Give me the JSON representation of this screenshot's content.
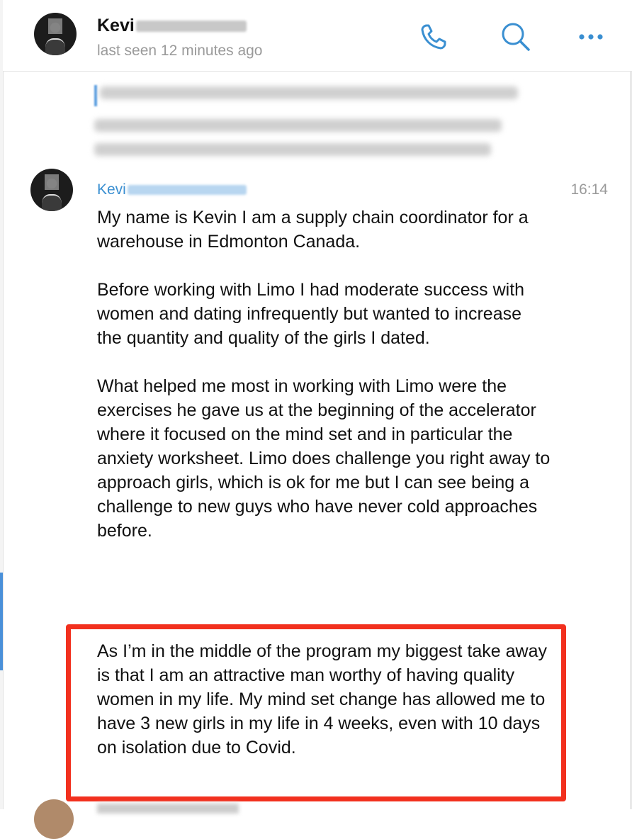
{
  "header": {
    "contact_name": "Kevi",
    "status": "last seen 12 minutes ago",
    "icons": [
      "phone-icon",
      "search-icon",
      "more-icon"
    ],
    "accent_color": "#3a8fd1"
  },
  "message": {
    "sender": "Kevi",
    "time": "16:14",
    "paragraphs": [
      "My name is Kevin I am a supply chain coordinator for a warehouse in Edmonton Canada.",
      "Before working with Limo I had moderate success with women and dating infrequently but wanted to increase the quantity and quality of the girls I dated.",
      "What helped me most in working with Limo were the exercises he gave us at the beginning of the accelerator where it focused on the mind set and in particular the anxiety worksheet. Limo does challenge you right away to approach girls, which is ok for me but I can see being a challenge to new guys who have never cold approaches before."
    ],
    "highlighted_paragraph": "As I’m in the middle of the program my biggest take away is that I am an attractive man worthy of having quality women in my life. My mind set change has allowed me to have  3 new girls in my life in 4 weeks, even with 10 days on isolation due to Covid.",
    "highlight_color": "#f2301e"
  }
}
